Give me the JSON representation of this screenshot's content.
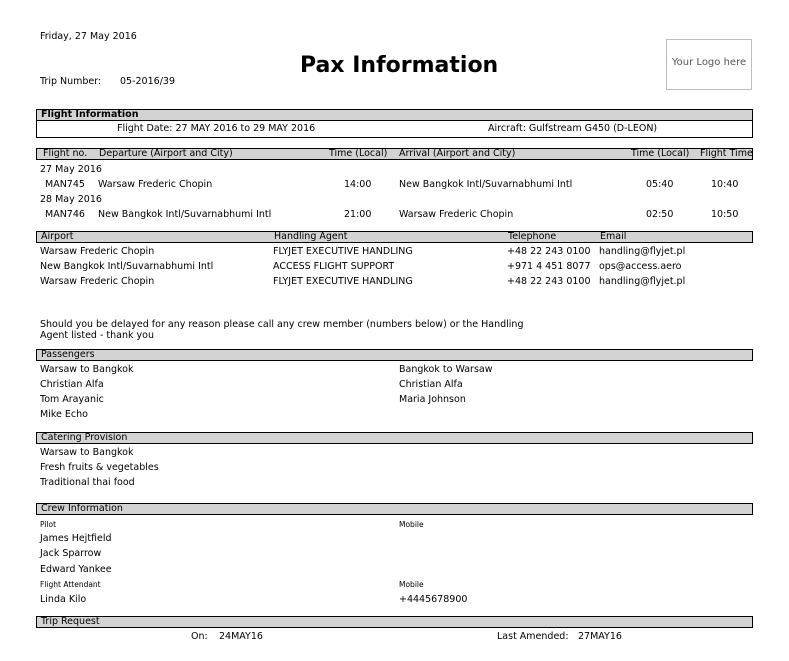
{
  "header": {
    "date": "Friday, 27 May 2016",
    "title": "Pax Information",
    "trip_number_label": "Trip Number:",
    "trip_number": "05-2016/39",
    "logo_text": "Your Logo here"
  },
  "flight_info": {
    "heading": "Flight Information",
    "flight_date": "Flight Date: 27 MAY 2016 to 29 MAY 2016",
    "aircraft": "Aircraft: Gulfstream G450 (D-LEON)"
  },
  "flights": {
    "columns": {
      "flight_no": "Flight no.",
      "departure": "Departure (Airport and City)",
      "dep_time": "Time (Local)",
      "arrival": "Arrival (Airport and City)",
      "arr_time": "Time (Local)",
      "flight_time": "Flight Time"
    },
    "groups": [
      {
        "date": "27 May 2016",
        "flight_no": "MAN745",
        "departure": "Warsaw Frederic Chopin",
        "dep_time": "14:00",
        "arrival": "New Bangkok Intl/Suvarnabhumi Intl",
        "arr_time": "05:40",
        "flight_time": "10:40"
      },
      {
        "date": "28 May 2016",
        "flight_no": "MAN746",
        "departure": "New Bangkok Intl/Suvarnabhumi Intl",
        "dep_time": "21:00",
        "arrival": "Warsaw Frederic Chopin",
        "arr_time": "02:50",
        "flight_time": "10:50"
      }
    ]
  },
  "handling": {
    "columns": {
      "airport": "Airport",
      "agent": "Handling Agent",
      "telephone": "Telephone",
      "email": "Email"
    },
    "rows": [
      {
        "airport": "Warsaw Frederic Chopin",
        "agent": "FLYJET EXECUTIVE HANDLING",
        "telephone": "+48 22 243 0100",
        "email": "handling@flyjet.pl"
      },
      {
        "airport": "New Bangkok Intl/Suvarnabhumi Intl",
        "agent": "ACCESS FLIGHT SUPPORT",
        "telephone": "+971 4 451 8077",
        "email": "ops@access.aero"
      },
      {
        "airport": "Warsaw Frederic Chopin",
        "agent": "FLYJET EXECUTIVE HANDLING",
        "telephone": "+48 22 243 0100",
        "email": "handling@flyjet.pl"
      }
    ]
  },
  "notice": {
    "line1": "Should you be delayed for any reason please call any crew member (numbers below) or the Handling",
    "line2": "Agent listed - thank you"
  },
  "passengers": {
    "heading": "Passengers",
    "left": [
      "Warsaw to Bangkok",
      "Christian Alfa",
      "Tom Arayanic",
      "Mike Echo"
    ],
    "right": [
      "Bangkok to Warsaw",
      "Christian Alfa",
      "Maria Johnson"
    ]
  },
  "catering": {
    "heading": "Catering Provision",
    "items": [
      "Warsaw to Bangkok",
      "Fresh fruits & vegetables",
      "Traditional thai food"
    ]
  },
  "crew": {
    "heading": "Crew Information",
    "pilot_label": "Pilot",
    "pilot_mobile_label": "Mobile",
    "pilots": [
      "James Hejtfield",
      "Jack Sparrow",
      "Edward Yankee"
    ],
    "attendant_label": "Flight Attendant",
    "attendant_mobile_label": "Mobile",
    "attendant": "Linda Kilo",
    "attendant_mobile": "+4445678900"
  },
  "trip_request": {
    "heading": "Trip Request",
    "on_label": "On:",
    "on_value": "24MAY16",
    "amended_label": "Last Amended:",
    "amended_value": "27MAY16"
  }
}
